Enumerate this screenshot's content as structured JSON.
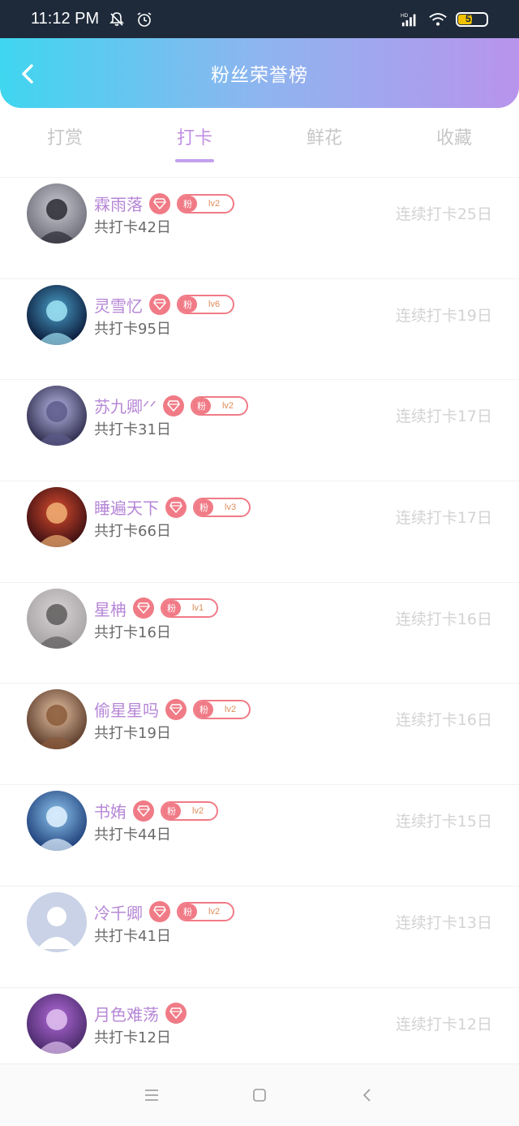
{
  "status": {
    "time": "11:12 PM",
    "battery": "51"
  },
  "header": {
    "title": "粉丝荣誉榜"
  },
  "tabs": [
    {
      "label": "打赏",
      "active": false
    },
    {
      "label": "打卡",
      "active": true
    },
    {
      "label": "鲜花",
      "active": false
    },
    {
      "label": "收藏",
      "active": false
    }
  ],
  "fans": [
    {
      "name": "霖雨落",
      "level": "lv2",
      "total": "共打卡42日",
      "streak": "连续打卡25日",
      "badge": true
    },
    {
      "name": "灵雪忆",
      "level": "lv6",
      "total": "共打卡95日",
      "streak": "连续打卡19日",
      "badge": true
    },
    {
      "name": "苏九卿ᐟᐟ",
      "level": "lv2",
      "total": "共打卡31日",
      "streak": "连续打卡17日",
      "badge": true
    },
    {
      "name": "睡遍天下",
      "level": "lv3",
      "total": "共打卡66日",
      "streak": "连续打卡17日",
      "badge": true
    },
    {
      "name": "星柟",
      "level": "lv1",
      "total": "共打卡16日",
      "streak": "连续打卡16日",
      "badge": true
    },
    {
      "name": "偷星星吗",
      "level": "lv2",
      "total": "共打卡19日",
      "streak": "连续打卡16日",
      "badge": true
    },
    {
      "name": "书姷",
      "level": "lv2",
      "total": "共打卡44日",
      "streak": "连续打卡15日",
      "badge": true
    },
    {
      "name": "冷千卿",
      "level": "lv2",
      "total": "共打卡41日",
      "streak": "连续打卡13日",
      "badge": true
    },
    {
      "name": "月色难荡",
      "level": "",
      "total": "共打卡12日",
      "streak": "连续打卡12日",
      "badge": false
    }
  ],
  "fan_badge_char": "粉",
  "colors": {
    "accent_purple": "#b686d6",
    "badge_red": "#f07b86",
    "header_gradient_start": "#3fd6f0",
    "header_gradient_end": "#b894ec"
  }
}
